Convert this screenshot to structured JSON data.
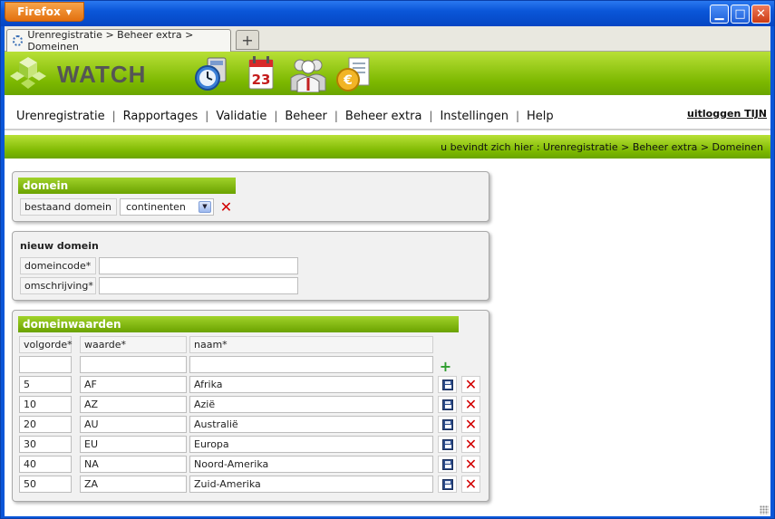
{
  "browser": {
    "app_button": "Firefox",
    "tab_title": "Urenregistratie > Beheer extra > Domeinen",
    "new_tab": "+"
  },
  "app": {
    "logo_text": "WATCH",
    "nav": [
      "Urenregistratie",
      "Rapportages",
      "Validatie",
      "Beheer",
      "Beheer extra",
      "Instellingen",
      "Help"
    ],
    "nav_separator": "|",
    "logout": "uitloggen TIJN",
    "breadcrumb": "u bevindt zich hier : Urenregistratie > Beheer extra > Domeinen"
  },
  "domein": {
    "title": "domein",
    "label": "bestaand domein",
    "selected": "continenten"
  },
  "nieuw_domein": {
    "title": "nieuw domein",
    "code_label": "domeincode*",
    "code_value": "",
    "desc_label": "omschrijving*",
    "desc_value": ""
  },
  "domeinwaarden": {
    "title": "domeinwaarden",
    "headers": [
      "volgorde*",
      "waarde*",
      "naam*"
    ],
    "new_row": [
      "",
      "",
      ""
    ],
    "rows": [
      [
        "5",
        "AF",
        "Afrika"
      ],
      [
        "10",
        "AZ",
        "Azië"
      ],
      [
        "20",
        "AU",
        "Australië"
      ],
      [
        "30",
        "EU",
        "Europa"
      ],
      [
        "40",
        "NA",
        "Noord-Amerika"
      ],
      [
        "50",
        "ZA",
        "Zuid-Amerika"
      ]
    ]
  },
  "icons": {
    "save": "floppy-disk-icon",
    "delete": "red-x-icon",
    "add": "green-plus-icon"
  },
  "colors": {
    "brand_green": "#7cb800",
    "header_green": "#6aa200",
    "delete_red": "#d20000",
    "title_blue": "#0a56d8"
  }
}
